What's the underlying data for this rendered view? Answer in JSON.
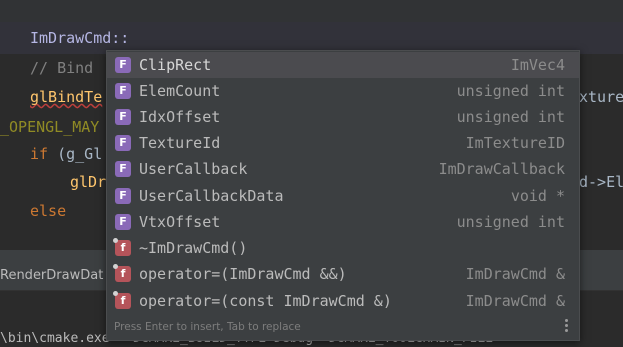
{
  "editor": {
    "lines": [
      {
        "text": "ImDrawCmd::"
      },
      {
        "text": "// Bind"
      },
      {
        "text": "glBindTe"
      },
      {
        "text": "_OPENGL_MAY"
      },
      {
        "kw": "if",
        "rest": " (g_Gl"
      },
      {
        "text": "glDr"
      },
      {
        "text": "else"
      }
    ],
    "right_fragments": [
      "xture",
      "d->El"
    ]
  },
  "tool_row": {
    "text": "RenderDrawDat"
  },
  "terminal": {
    "text": "\\bin\\cmake.exe  -DCMAKE_BUILD_TYPE=Debug -DCMAKE_TOOLCHAIN_FILE"
  },
  "completion": {
    "items": [
      {
        "kind": "f",
        "name": "ClipRect",
        "type": "ImVec4"
      },
      {
        "kind": "f",
        "name": "ElemCount",
        "type": "unsigned int"
      },
      {
        "kind": "f",
        "name": "IdxOffset",
        "type": "unsigned int"
      },
      {
        "kind": "f",
        "name": "TextureId",
        "type": "ImTextureID"
      },
      {
        "kind": "f",
        "name": "UserCallback",
        "type": "ImDrawCallback"
      },
      {
        "kind": "f",
        "name": "UserCallbackData",
        "type": "void *"
      },
      {
        "kind": "f",
        "name": "VtxOffset",
        "type": "unsigned int"
      },
      {
        "kind": "m",
        "name": "~ImDrawCmd()",
        "type": ""
      },
      {
        "kind": "m",
        "name": "operator=(ImDrawCmd &&)",
        "type": "ImDrawCmd &"
      },
      {
        "kind": "m",
        "name": "operator=(const ImDrawCmd &)",
        "type": "ImDrawCmd &"
      }
    ],
    "field_icon_letter": "F",
    "method_icon_letter": "f",
    "hint": "Press Enter to insert, Tab to replace"
  },
  "colors": {
    "editor_bg": "#2b2b2b",
    "popup_bg": "#3c3f41",
    "selected_bg": "#4b4b4f",
    "field_icon": "#8a6ab8",
    "method_icon": "#b5545a"
  }
}
